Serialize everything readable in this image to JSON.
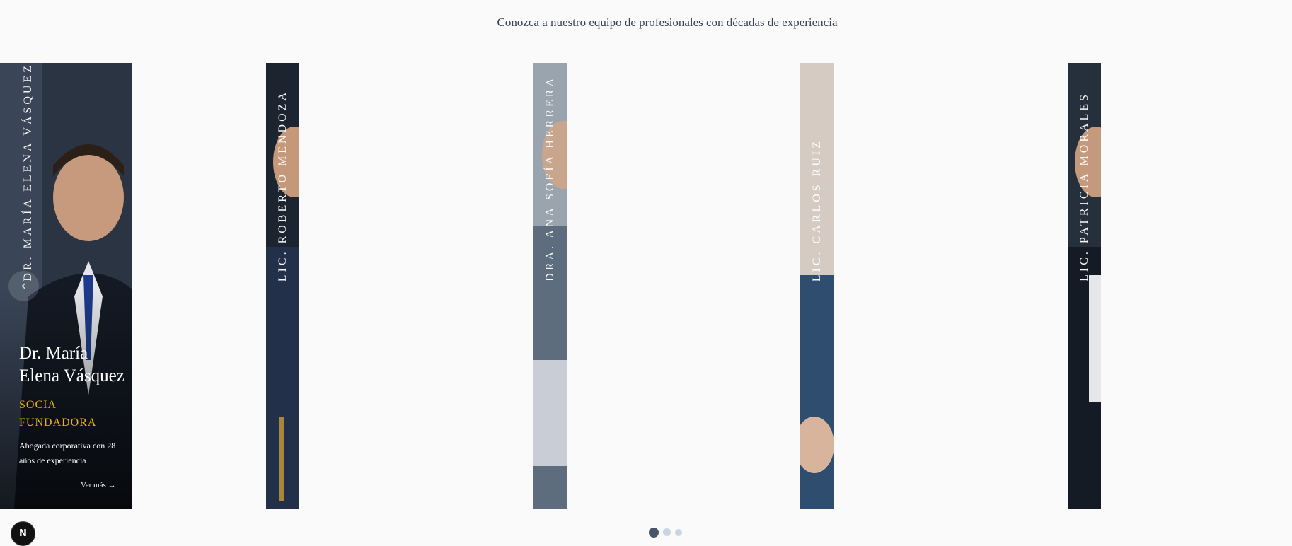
{
  "header": {
    "subtitle": "Conozca a nuestro equipo de profesionales con décadas de experiencia"
  },
  "featured": {
    "name": "Dr. María Elena Vásquez",
    "role": "SOCIA FUNDADORA",
    "description": "Abogada corporativa con 28 años de experiencia",
    "more_label": "Ver más →"
  },
  "team": [
    {
      "vertical_label": "Dr. María Elena Vásquez"
    },
    {
      "vertical_label": "Lic. Roberto Mendoza"
    },
    {
      "vertical_label": "Dra. Ana Sofía Herrera"
    },
    {
      "vertical_label": "Lic. Carlos Ruiz"
    },
    {
      "vertical_label": "Lic. Patricia Morales"
    }
  ],
  "carousel": {
    "prev_icon": "chevron-left-icon",
    "page_count": 3,
    "current_page": 1
  },
  "badge": {
    "label": "N"
  },
  "colors": {
    "accent": "#eab308",
    "background": "#fafafa",
    "card": "#1f2937"
  }
}
